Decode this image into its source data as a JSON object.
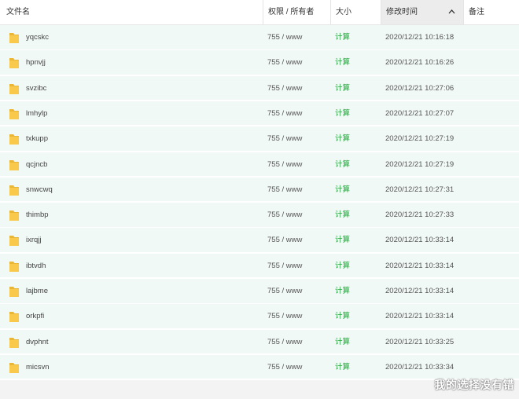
{
  "header": {
    "name": "文件名",
    "permissions": "权限 / 所有者",
    "size": "大小",
    "modified": "修改时间",
    "notes": "备注",
    "sort_indicator": "chevron-up-icon"
  },
  "files": [
    {
      "name": "yqcskc",
      "permissions": "755 / www",
      "size": "计算",
      "modified": "2020/12/21 10:16:18"
    },
    {
      "name": "hpnvjj",
      "permissions": "755 / www",
      "size": "计算",
      "modified": "2020/12/21 10:16:26"
    },
    {
      "name": "svzibc",
      "permissions": "755 / www",
      "size": "计算",
      "modified": "2020/12/21 10:27:06"
    },
    {
      "name": "lmhylp",
      "permissions": "755 / www",
      "size": "计算",
      "modified": "2020/12/21 10:27:07"
    },
    {
      "name": "txkupp",
      "permissions": "755 / www",
      "size": "计算",
      "modified": "2020/12/21 10:27:19"
    },
    {
      "name": "qcjncb",
      "permissions": "755 / www",
      "size": "计算",
      "modified": "2020/12/21 10:27:19"
    },
    {
      "name": "snwcwq",
      "permissions": "755 / www",
      "size": "计算",
      "modified": "2020/12/21 10:27:31"
    },
    {
      "name": "thimbp",
      "permissions": "755 / www",
      "size": "计算",
      "modified": "2020/12/21 10:27:33"
    },
    {
      "name": "ixrqjj",
      "permissions": "755 / www",
      "size": "计算",
      "modified": "2020/12/21 10:33:14"
    },
    {
      "name": "ibtvdh",
      "permissions": "755 / www",
      "size": "计算",
      "modified": "2020/12/21 10:33:14"
    },
    {
      "name": "lajbme",
      "permissions": "755 / www",
      "size": "计算",
      "modified": "2020/12/21 10:33:14"
    },
    {
      "name": "orkpfi",
      "permissions": "755 / www",
      "size": "计算",
      "modified": "2020/12/21 10:33:14"
    },
    {
      "name": "dvphnt",
      "permissions": "755 / www",
      "size": "计算",
      "modified": "2020/12/21 10:33:25"
    },
    {
      "name": "micsvn",
      "permissions": "755 / www",
      "size": "计算",
      "modified": "2020/12/21 10:33:34"
    }
  ],
  "icons": {
    "file_type": "folder-icon"
  },
  "colors": {
    "row_bg": "#f1f9f6",
    "size_link": "#20a53a",
    "folder_yellow": "#f8c94a"
  },
  "watermark": "我的选择没有错"
}
